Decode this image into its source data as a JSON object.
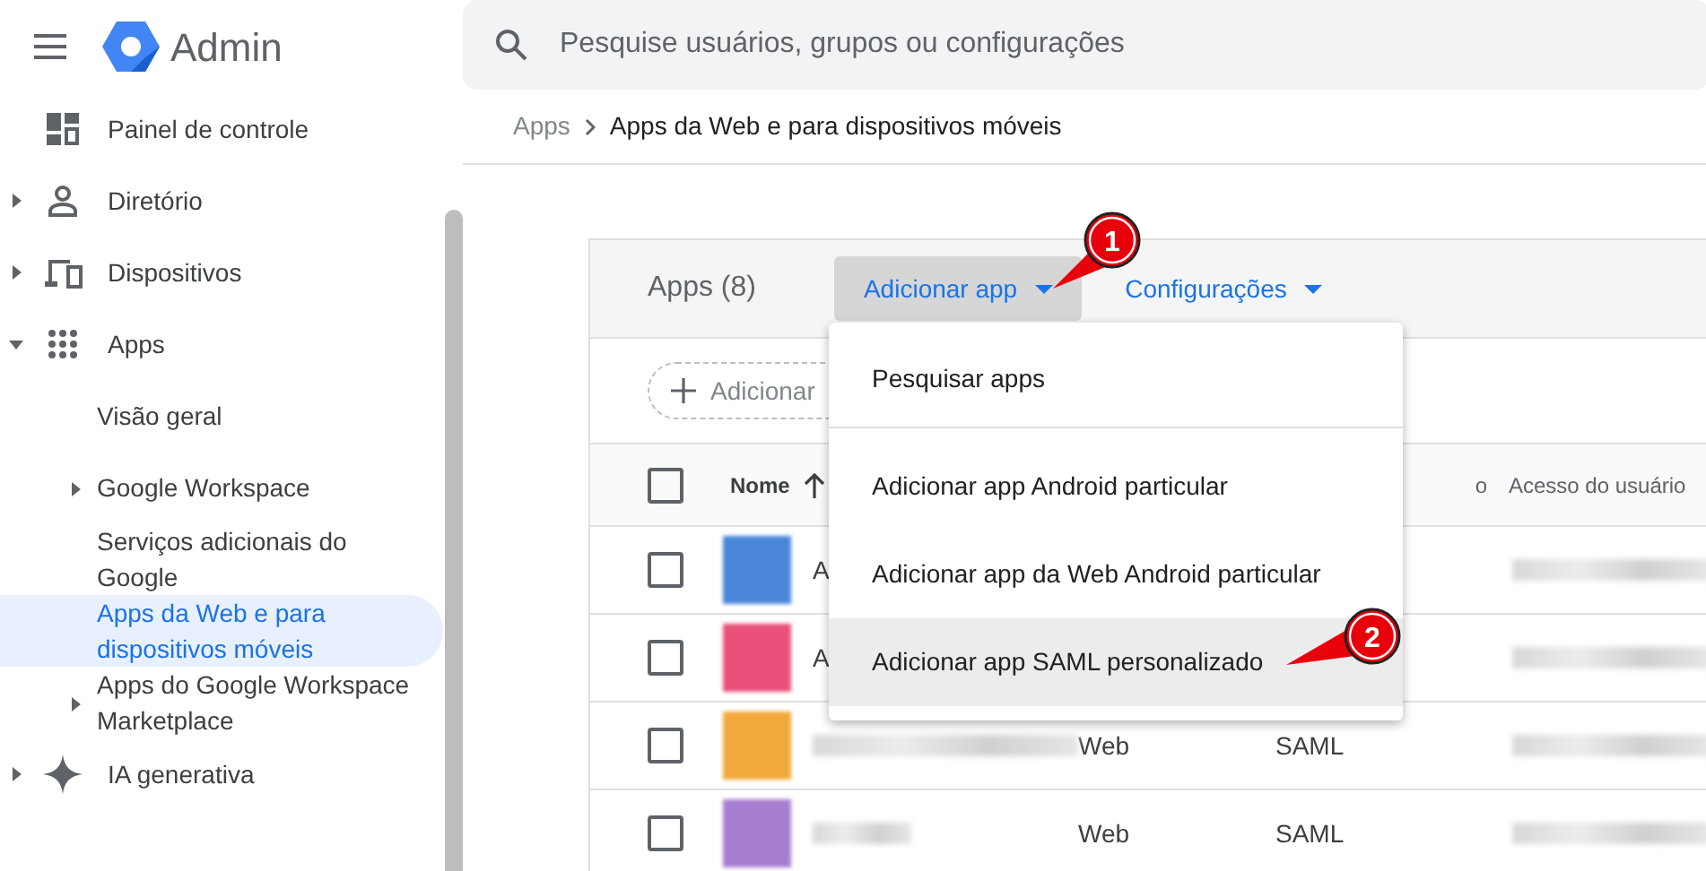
{
  "header": {
    "product": "Admin",
    "search": {
      "placeholder": "Pesquise usuários, grupos ou configurações"
    }
  },
  "sidebar": {
    "items": [
      {
        "label": "Painel de controle"
      },
      {
        "label": "Diretório",
        "expandable": true,
        "expanded": false
      },
      {
        "label": "Dispositivos",
        "expandable": true,
        "expanded": false
      },
      {
        "label": "Apps",
        "expandable": true,
        "expanded": true,
        "children": [
          {
            "label": "Visão geral",
            "selected": false
          },
          {
            "label": "Google Workspace",
            "expandable": true,
            "selected": false
          },
          {
            "label": "Serviços adicionais do Google",
            "selected": false
          },
          {
            "label": "Apps da Web e para dispositivos móveis",
            "selected": true
          },
          {
            "label": "Apps do Google Workspace Marketplace",
            "expandable": true,
            "selected": false
          }
        ]
      },
      {
        "label": "IA generativa",
        "expandable": true,
        "expanded": false
      }
    ]
  },
  "breadcrumb": [
    "Apps",
    "Apps da Web e para dispositivos móveis"
  ],
  "panel": {
    "title": "Apps (8)",
    "actions": [
      {
        "label": "Adicionar app",
        "selected": true
      },
      {
        "label": "Configurações",
        "selected": false
      }
    ],
    "filter_chip": "Adicionar",
    "table": {
      "select_all_checked": false,
      "columns": [
        "Nome",
        "o",
        "Acesso do usuário"
      ],
      "rows": [
        {
          "name": "A",
          "color": "#4a86d8",
          "checked": false
        },
        {
          "name": "A",
          "color": "#e8507a",
          "checked": false
        },
        {
          "type": "Web",
          "protocol": "SAML",
          "color": "#f2a93b",
          "checked": false
        },
        {
          "type": "Web",
          "protocol": "SAML",
          "color": "#a67ed0",
          "checked": false
        }
      ]
    }
  },
  "menu": {
    "items": [
      {
        "label": "Pesquisar apps",
        "selected": false
      },
      {
        "label": "Adicionar app Android particular",
        "selected": false
      },
      {
        "label": "Adicionar app da Web Android particular",
        "selected": false
      },
      {
        "label": "Adicionar app SAML personalizado",
        "selected": true
      }
    ]
  },
  "callouts": [
    {
      "label": "1"
    },
    {
      "label": "2"
    }
  ]
}
